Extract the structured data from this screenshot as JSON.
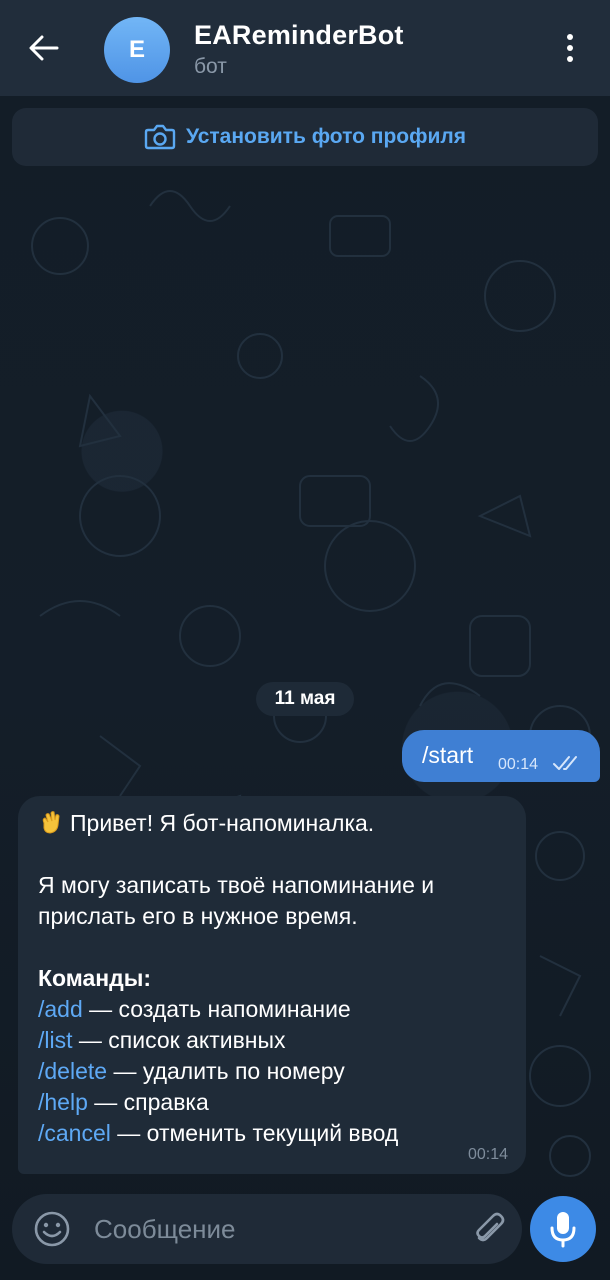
{
  "header": {
    "avatar_letter": "E",
    "bot_name": "EAReminderBot",
    "status": "бот",
    "back_icon": "arrow-left-icon",
    "menu_icon": "more-vertical-icon"
  },
  "banner": {
    "label": "Установить фото профиля",
    "icon": "camera-icon"
  },
  "chat": {
    "date": "11 мая",
    "outgoing": {
      "text": "/start",
      "time": "00:14",
      "status_icon": "double-check-icon"
    },
    "incoming": {
      "greeting": "Привет! Я бот-напоминалка.",
      "greeting_icon": "waving-hand-emoji",
      "intro_line1": "Я могу записать твоё напоминание и",
      "intro_line2": "прислать его в нужное время.",
      "commands_title": "Команды:",
      "commands": [
        {
          "cmd": "/add",
          "desc": " — создать напоминание"
        },
        {
          "cmd": "/list",
          "desc": " — список активных"
        },
        {
          "cmd": "/delete",
          "desc": " — удалить по номеру"
        },
        {
          "cmd": "/help",
          "desc": " — справка"
        },
        {
          "cmd": "/cancel",
          "desc": " — отменить текущий ввод"
        }
      ],
      "time": "00:14"
    }
  },
  "composer": {
    "placeholder": "Сообщение",
    "emoji_icon": "emoji-icon",
    "attach_icon": "paperclip-icon",
    "mic_icon": "microphone-icon"
  },
  "colors": {
    "header_bg": "#212d3b",
    "accent": "#3d8ae6",
    "outgoing_bubble": "#3f7fd3",
    "incoming_bubble": "#1f2b38",
    "link": "#5ea9f5"
  }
}
